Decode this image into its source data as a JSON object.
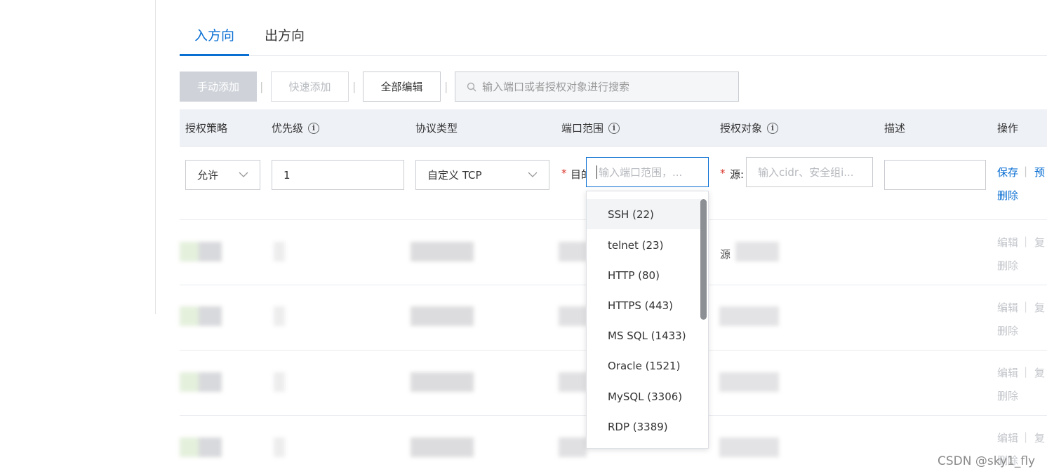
{
  "tabs": [
    {
      "label": "入方向",
      "active": true
    },
    {
      "label": "出方向",
      "active": false
    }
  ],
  "toolbar": {
    "manual_add": "手动添加",
    "quick_add": "快速添加",
    "edit_all": "全部编辑",
    "separator": "|",
    "search_placeholder": "输入端口或者授权对象进行搜索"
  },
  "table": {
    "columns": [
      "授权策略",
      "优先级",
      "协议类型",
      "端口范围",
      "授权对象",
      "描述",
      "操作"
    ]
  },
  "edit_row": {
    "policy": "允许",
    "priority": "1",
    "protocol": "自定义 TCP",
    "required_mark": "*",
    "dest_label": "目的",
    "port_placeholder": "输入端口范围，...",
    "source_label": "源:",
    "source_placeholder": "输入cidr、安全组i...",
    "description": "",
    "save": "保存",
    "preview": "预",
    "delete": "删除",
    "separator": "|"
  },
  "data_rows": {
    "source_label": "源",
    "edit": "编辑",
    "copy": "复",
    "delete": "删除",
    "separator": "|"
  },
  "port_dropdown": {
    "options": [
      "SSH (22)",
      "telnet (23)",
      "HTTP (80)",
      "HTTPS (443)",
      "MS SQL (1433)",
      "Oracle (1521)",
      "MySQL (3306)",
      "RDP (3389)"
    ],
    "highlighted": "SSH (22)"
  },
  "watermark": "CSDN @sky1_fly",
  "colors": {
    "accent": "#0a6fd3",
    "required": "#d93026",
    "header_bg": "#eef1f6"
  }
}
